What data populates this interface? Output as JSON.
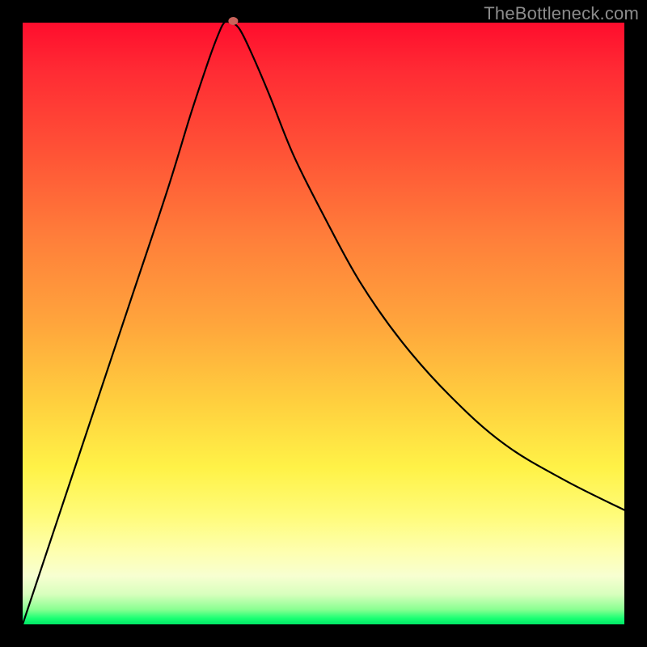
{
  "watermark": "TheBottleneck.com",
  "chart_data": {
    "type": "line",
    "title": "",
    "xlabel": "",
    "ylabel": "",
    "xlim": [
      0,
      100
    ],
    "ylim": [
      0,
      100
    ],
    "grid": false,
    "legend": false,
    "curve_points": [
      {
        "x": 0,
        "y": 0
      },
      {
        "x": 6,
        "y": 18
      },
      {
        "x": 12,
        "y": 36
      },
      {
        "x": 18,
        "y": 54
      },
      {
        "x": 24,
        "y": 72
      },
      {
        "x": 28,
        "y": 85
      },
      {
        "x": 31,
        "y": 94
      },
      {
        "x": 32.5,
        "y": 98
      },
      {
        "x": 33.5,
        "y": 100
      },
      {
        "x": 34.5,
        "y": 100
      },
      {
        "x": 36,
        "y": 99
      },
      {
        "x": 38,
        "y": 95
      },
      {
        "x": 41,
        "y": 88
      },
      {
        "x": 45,
        "y": 78
      },
      {
        "x": 50,
        "y": 68
      },
      {
        "x": 56,
        "y": 57
      },
      {
        "x": 63,
        "y": 47
      },
      {
        "x": 71,
        "y": 38
      },
      {
        "x": 80,
        "y": 30
      },
      {
        "x": 90,
        "y": 24
      },
      {
        "x": 100,
        "y": 19
      }
    ],
    "marker": {
      "x": 35,
      "y": 100,
      "color": "#c9625a",
      "rx": 6,
      "ry": 5
    },
    "curve_color": "#000000",
    "curve_width": 2.2
  }
}
